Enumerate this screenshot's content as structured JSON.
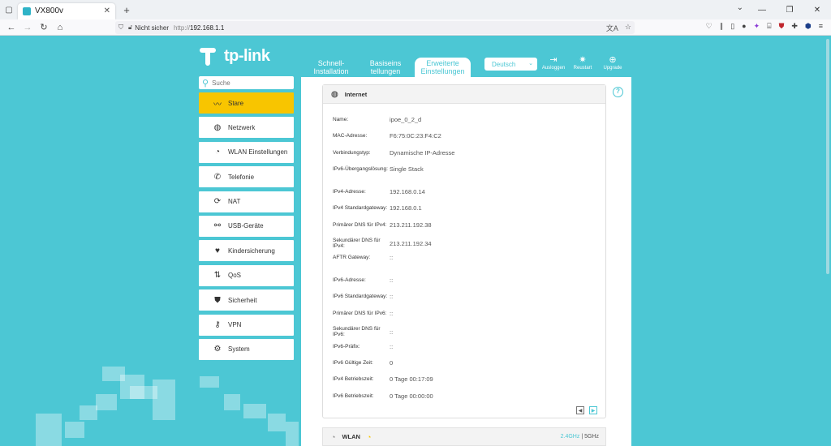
{
  "browser": {
    "tab_title": "VX800v",
    "url_insecure_label": "Nicht sicher",
    "url_protocol": "http://",
    "url_host": "192.168.1.1"
  },
  "header": {
    "logo_text": "tp-link",
    "tabs": [
      {
        "label_line1": "Schnell-",
        "label_line2": "Installation"
      },
      {
        "label_line1": "Basiseins",
        "label_line2": "tellungen"
      },
      {
        "label_line1": "Erweiterte",
        "label_line2": "Einstellungen"
      }
    ],
    "language": "Deutsch",
    "buttons": [
      {
        "label": "Ausloggen",
        "icon": "logout-icon"
      },
      {
        "label": "Reustart",
        "icon": "reboot-icon"
      },
      {
        "label": "Upgrade",
        "icon": "upgrade-icon"
      }
    ]
  },
  "sidebar": {
    "search_placeholder": "Suche",
    "items": [
      {
        "label": "Stare",
        "icon": "pulse-icon"
      },
      {
        "label": "Netzwerk",
        "icon": "globe-icon"
      },
      {
        "label": "WLAN Einstellungen",
        "icon": "wifi-icon"
      },
      {
        "label": "Telefonie",
        "icon": "phone-icon"
      },
      {
        "label": "NAT",
        "icon": "nat-icon"
      },
      {
        "label": "USB-Geräte",
        "icon": "usb-icon"
      },
      {
        "label": "Kindersicherung",
        "icon": "heart-icon"
      },
      {
        "label": "QoS",
        "icon": "qos-icon"
      },
      {
        "label": "Sicherheit",
        "icon": "shield-icon"
      },
      {
        "label": "VPN",
        "icon": "key-icon"
      },
      {
        "label": "System",
        "icon": "gear-icon"
      }
    ]
  },
  "internet": {
    "title": "Internet",
    "rows": [
      {
        "key": "Name:",
        "value": "ipoe_0_2_d"
      },
      {
        "key": "MAC-Adresse:",
        "value": "F6:75:0C:23:F4:C2"
      },
      {
        "key": "Verbindungstyp:",
        "value": "Dynamische IP-Adresse"
      },
      {
        "key": "IPv6-Übergangslösung:",
        "value": "Single Stack"
      },
      {
        "key": "IPv4-Adresse:",
        "value": "192.168.0.14"
      },
      {
        "key": "IPv4 Standardgateway:",
        "value": "192.168.0.1"
      },
      {
        "key": "Primärer DNS für IPv4:",
        "value": "213.211.192.38"
      },
      {
        "key": "Sekundärer DNS für IPv4:",
        "value": "213.211.192.34"
      },
      {
        "key": "AFTR Gateway:",
        "value": "::"
      },
      {
        "key": "IPv6-Adresse:",
        "value": "::"
      },
      {
        "key": "IPv6 Standardgateway:",
        "value": "::"
      },
      {
        "key": "Primärer DNS für IPv6:",
        "value": "::"
      },
      {
        "key": "Sekundärer DNS für IPv6:",
        "value": "::"
      },
      {
        "key": "IPv6-Präfix:",
        "value": "::"
      },
      {
        "key": "IPv6 Gültige Zeit:",
        "value": "0"
      },
      {
        "key": "IPv4 Betriebszeit:",
        "value": "0 Tage 00:17:09"
      },
      {
        "key": "IPv6 Betriebszeit:",
        "value": "0 Tage 00:00:00"
      }
    ]
  },
  "wlan": {
    "title": "WLAN",
    "band1": "2.4GHz",
    "separator": "|",
    "band2": "5GHz"
  }
}
